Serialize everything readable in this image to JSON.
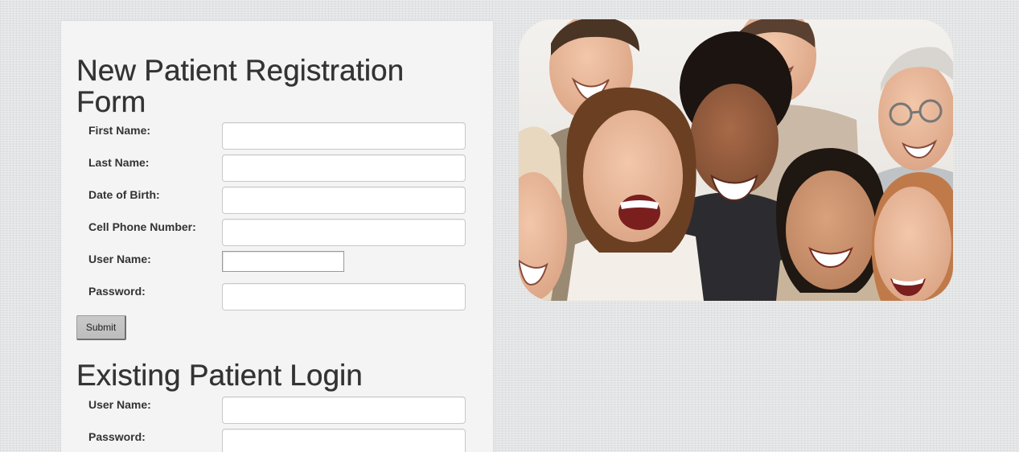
{
  "new_patient": {
    "title": "New Patient Registration Form",
    "fields": [
      {
        "label": "First Name:",
        "value": ""
      },
      {
        "label": "Last Name:",
        "value": ""
      },
      {
        "label": "Date of Birth:",
        "value": ""
      },
      {
        "label": "Cell Phone Number:",
        "value": ""
      },
      {
        "label": "User Name:",
        "value": ""
      },
      {
        "label": "Password:",
        "value": ""
      }
    ],
    "submit_label": "Submit"
  },
  "existing_patient": {
    "title": "Existing Patient Login",
    "fields": [
      {
        "label": "User Name:",
        "value": ""
      },
      {
        "label": "Password:",
        "value": ""
      }
    ]
  },
  "hero_image": {
    "subject": "group of smiling people photo"
  },
  "colors": {
    "page_background": "#e3e4e5",
    "panel_background": "#f4f4f4",
    "heading_text": "#333333",
    "button_background": "#c4c4c4"
  }
}
